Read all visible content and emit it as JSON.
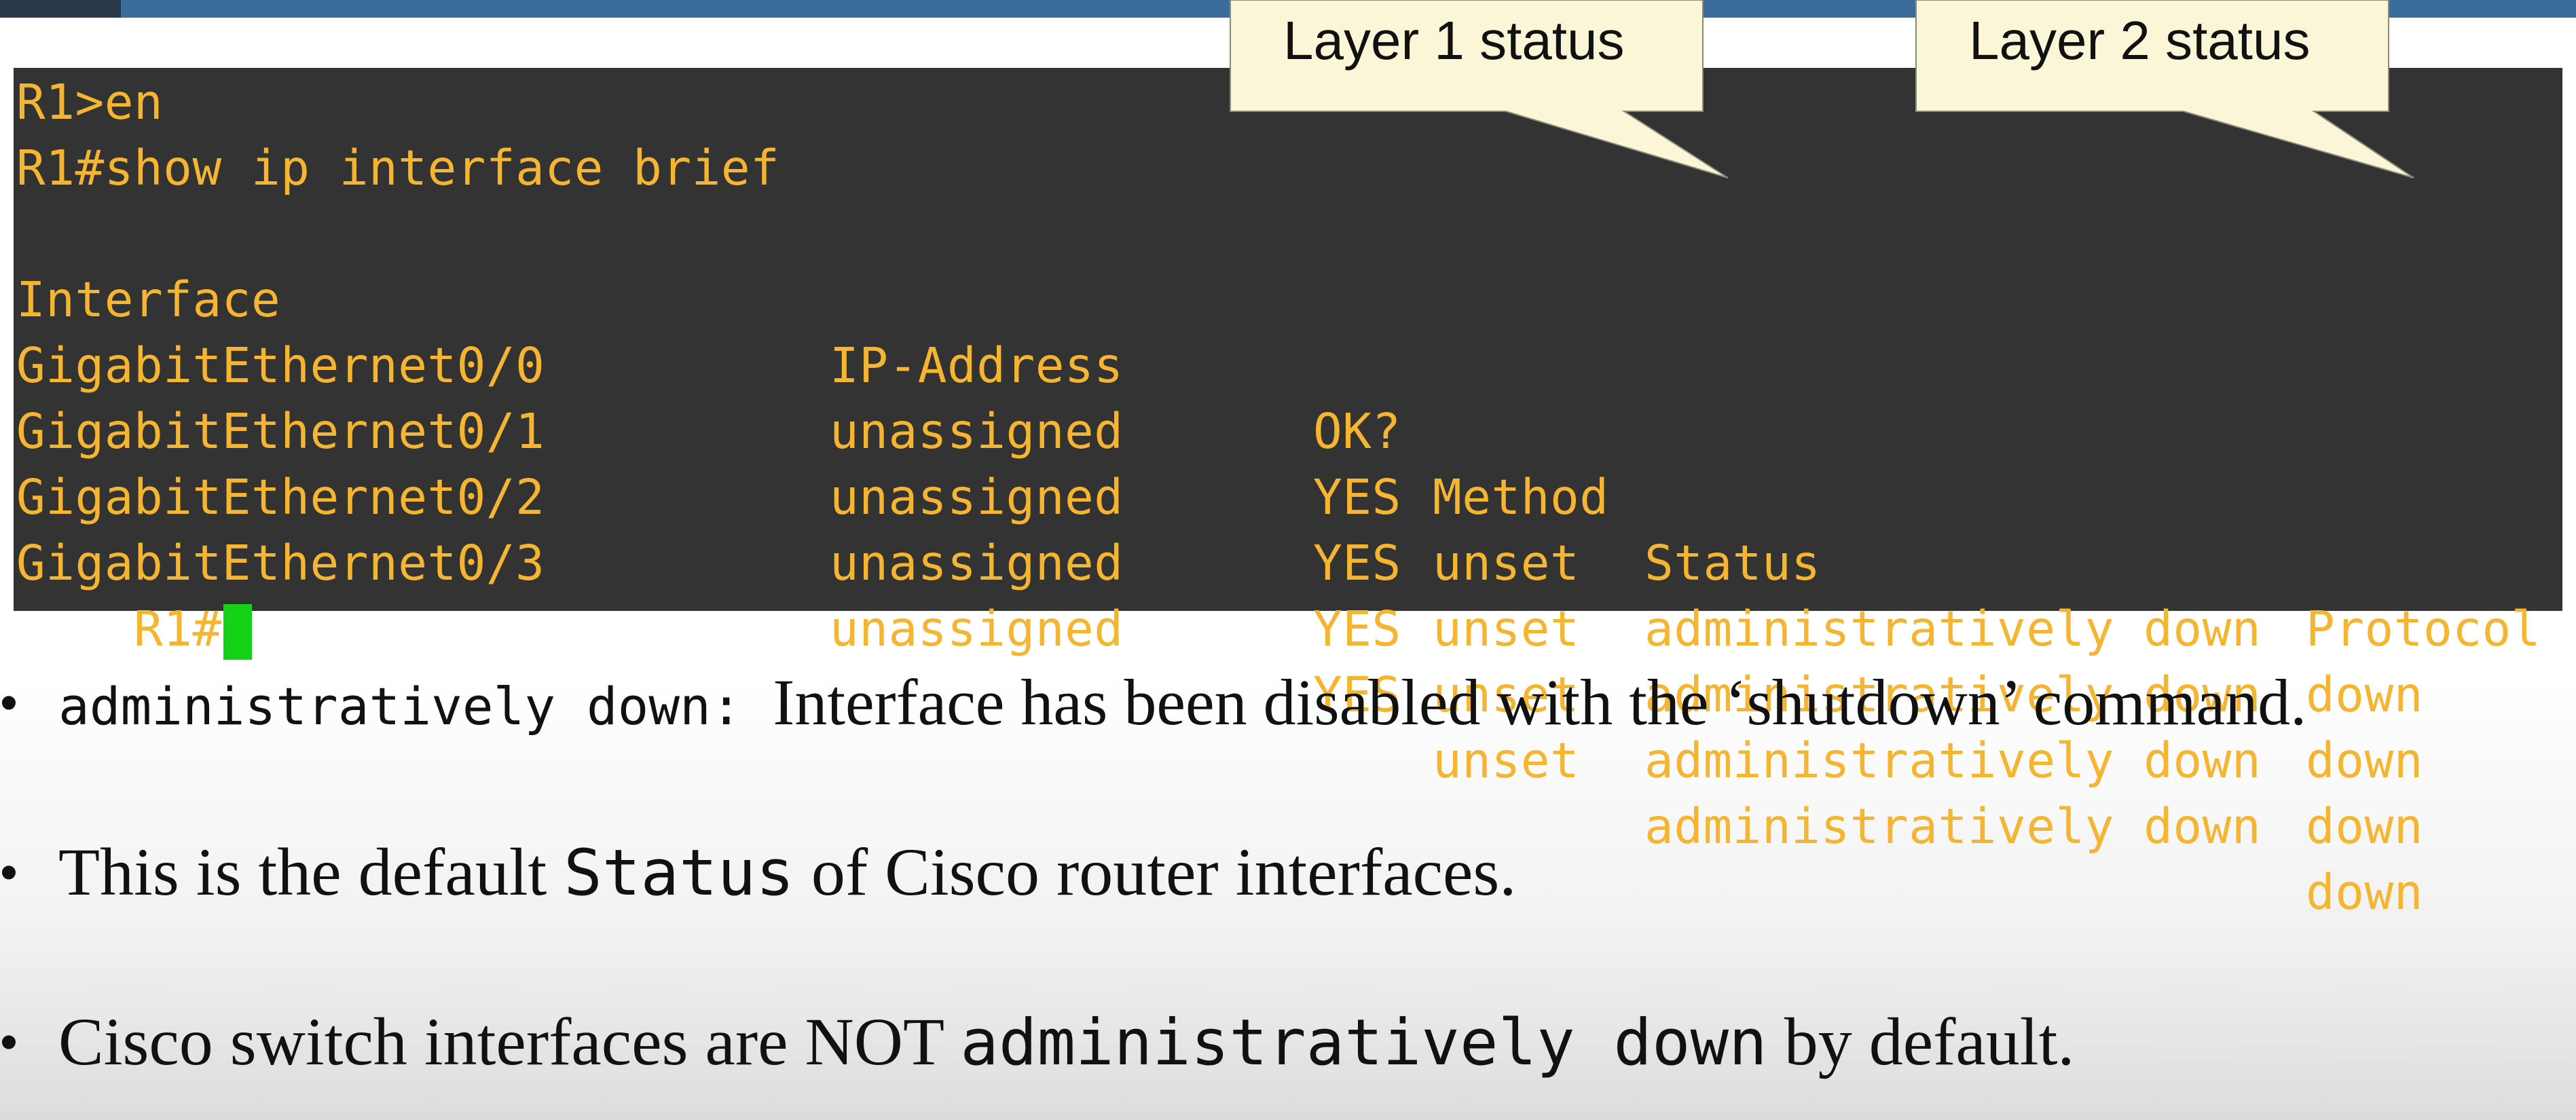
{
  "terminal": {
    "lines": [
      "R1>en",
      "R1#show ip interface brief"
    ],
    "table": {
      "headers": [
        "Interface",
        "IP-Address",
        "OK?",
        "Method",
        "Status",
        "Protocol"
      ],
      "rows": [
        [
          "GigabitEthernet0/0",
          "unassigned",
          "YES",
          "unset",
          "administratively down",
          "down"
        ],
        [
          "GigabitEthernet0/1",
          "unassigned",
          "YES",
          "unset",
          "administratively down",
          "down"
        ],
        [
          "GigabitEthernet0/2",
          "unassigned",
          "YES",
          "unset",
          "administratively down",
          "down"
        ],
        [
          "GigabitEthernet0/3",
          "unassigned",
          "YES",
          "unset",
          "administratively down",
          "down"
        ]
      ]
    },
    "prompt": "R1#"
  },
  "callouts": {
    "layer1": "Layer 1 status",
    "layer2": "Layer 2 status"
  },
  "bullets": [
    {
      "parts": [
        {
          "text": "administratively down: ",
          "style": "mono"
        },
        {
          "text": "Interface has been disabled with the ‘shutdown’ command.",
          "style": "serif"
        }
      ]
    },
    {
      "parts": [
        {
          "text": "This is the default ",
          "style": "serif"
        },
        {
          "text": "Status",
          "style": "mono"
        },
        {
          "text": " of Cisco router interfaces.",
          "style": "serif"
        }
      ]
    },
    {
      "parts": [
        {
          "text": "Cisco switch interfaces are NOT ",
          "style": "serif"
        },
        {
          "text": "administratively down",
          "style": "mono"
        },
        {
          "text": " by default.",
          "style": "serif"
        }
      ]
    }
  ],
  "bullet_glyph": "•",
  "colors": {
    "terminal_bg": "#333333",
    "terminal_text": "#f5b530",
    "cursor": "#16d216",
    "callout_fill": "#fcf6d8",
    "top_bar": "#3b6d9c"
  }
}
